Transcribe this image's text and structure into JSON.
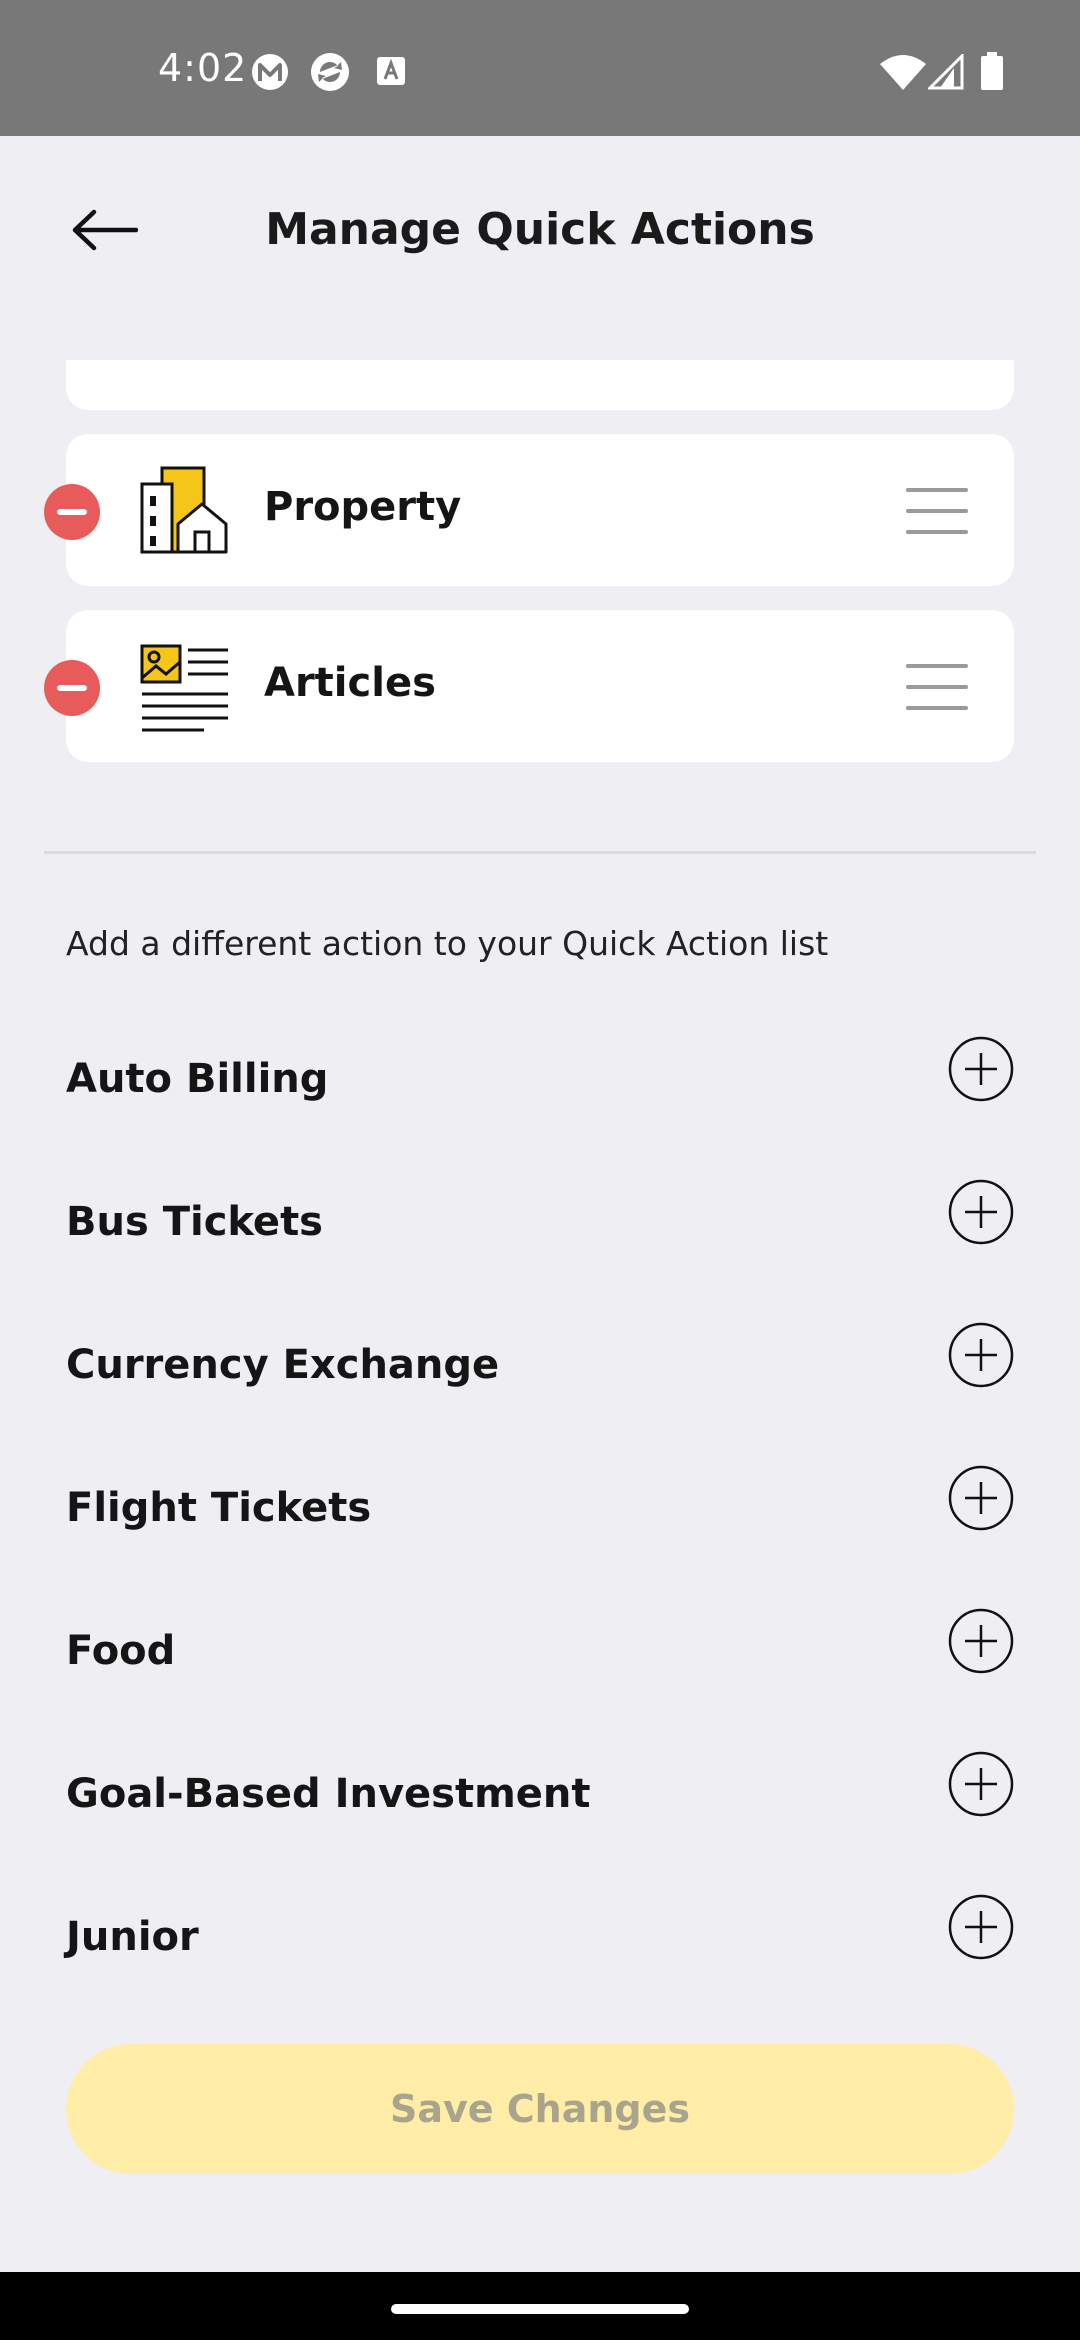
{
  "status_bar": {
    "time": "4:02",
    "icons": [
      "m-logo-icon",
      "sync-icon",
      "a-badge-icon",
      "wifi-icon",
      "signal-icon",
      "battery-icon"
    ]
  },
  "header": {
    "back_icon": "arrow-left-icon",
    "title": "Manage Quick Actions"
  },
  "selected_actions": [
    {
      "label": "Property",
      "icon": "property-building-icon"
    },
    {
      "label": "Articles",
      "icon": "articles-newspaper-icon"
    }
  ],
  "add_section": {
    "hint": "Add a different action to your Quick Action list",
    "items": [
      {
        "label": "Auto Billing"
      },
      {
        "label": "Bus Tickets"
      },
      {
        "label": "Currency Exchange"
      },
      {
        "label": "Flight Tickets"
      },
      {
        "label": "Food"
      },
      {
        "label": "Goal-Based Investment"
      },
      {
        "label": "Junior"
      }
    ]
  },
  "save_button": {
    "label": "Save Changes"
  },
  "colors": {
    "accent_yellow": "#F5C518",
    "remove_red": "#E85B5B",
    "save_disabled_bg": "#FFEDA8",
    "save_disabled_text": "#A9A58C",
    "background": "#EEEEF3"
  }
}
